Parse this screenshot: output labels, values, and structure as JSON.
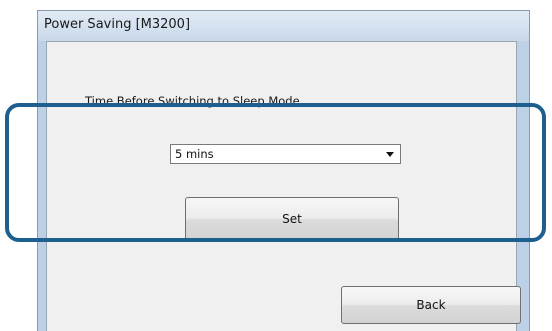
{
  "window": {
    "title": "Power Saving [M3200]"
  },
  "main": {
    "prompt_label": "Time Before Switching to Sleep Mode",
    "sleep_select": {
      "selected_value": "5 mins"
    },
    "set_button_label": "Set",
    "back_button_label": "Back"
  },
  "colors": {
    "frame": "#bdd1e6",
    "client_background": "#f0f0f0",
    "highlight_outline": "#1d5f8f"
  }
}
